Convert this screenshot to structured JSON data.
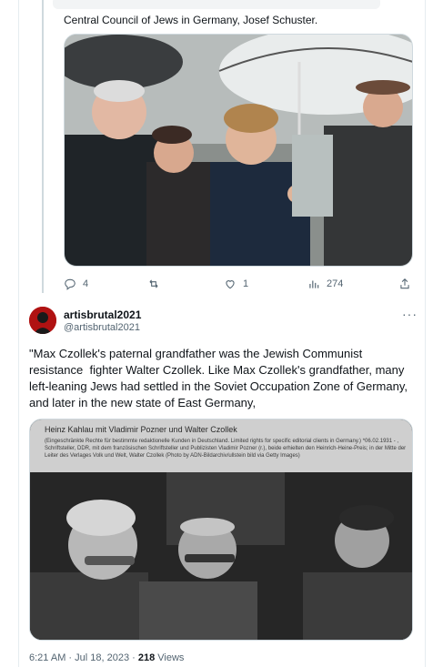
{
  "tweet1": {
    "caption": "Central Council of Jews in Germany, Josef Schuster.",
    "stats": {
      "replies": "4",
      "retweets": "",
      "likes": "1",
      "views": "274"
    }
  },
  "tweet2": {
    "author_name": "artisbrutal2021",
    "handle": "@artisbrutal2021",
    "more_label": "···",
    "text": "\"Max Czollek's paternal grandfather was the Jewish Communist resistance  fighter Walter Czollek. Like Max Czollek's grandfather, many left-leaning Jews had settled in the Soviet Occupation Zone of Germany, and later in the new state of East Germany,",
    "photo": {
      "title": "Heinz Kahlau mit Vladimir Pozner und Walter Czollek",
      "credit": "(Eingeschränkte Rechte für bestimmte redaktionelle Kunden in Deutschland. Limited rights for specific editorial clients in Germany.) *06.02.1931 - , Schriftsteller, DDR, mit dem französischen Schriftsteller und Publizisten Vladimir Pozner (r.), beide erhielten den Heinrich-Heine-Preis; in der Mitte der Leiter des Verlages Volk und Welt, Walter Czollek (Photo by ADN-Bildarchiv/ullstein bild via Getty Images)"
    },
    "meta": {
      "time": "6:21 AM · Jul 18, 2023 · ",
      "views_count": "218",
      "views_label": " Views"
    }
  },
  "icons": {
    "reply": "reply-icon",
    "retweet": "retweet-icon",
    "like": "heart-icon",
    "views": "views-icon",
    "share": "share-icon"
  }
}
